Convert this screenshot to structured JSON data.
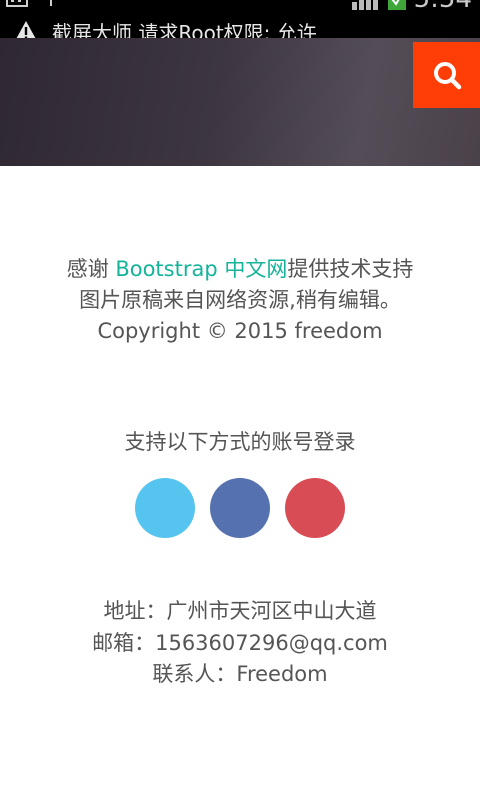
{
  "status_bar": {
    "notification": "截屏大师 请求Root权限: 允许",
    "time": "5:54"
  },
  "hero": {
    "search_icon": "search-icon",
    "accent_color": "#fe3d07"
  },
  "credits": {
    "thanks_prefix": "感谢 ",
    "link_text": "Bootstrap 中文网",
    "thanks_suffix": "提供技术支持",
    "line2": "图片原稿来自网络资源,稍有编辑。",
    "line3": "Copyright © 2015 freedom",
    "link_color": "#14b39a"
  },
  "login": {
    "label": "支持以下方式的账号登录",
    "providers": [
      {
        "icon": "twitter-icon",
        "color": "#55c5ef"
      },
      {
        "icon": "facebook-icon",
        "color": "#5671b0"
      },
      {
        "icon": "weibo-icon",
        "color": "#d84c56"
      }
    ]
  },
  "contact": {
    "address": "地址：广州市天河区中山大道",
    "email": "邮箱：1563607296@qq.com",
    "person": "联系人：Freedom"
  }
}
